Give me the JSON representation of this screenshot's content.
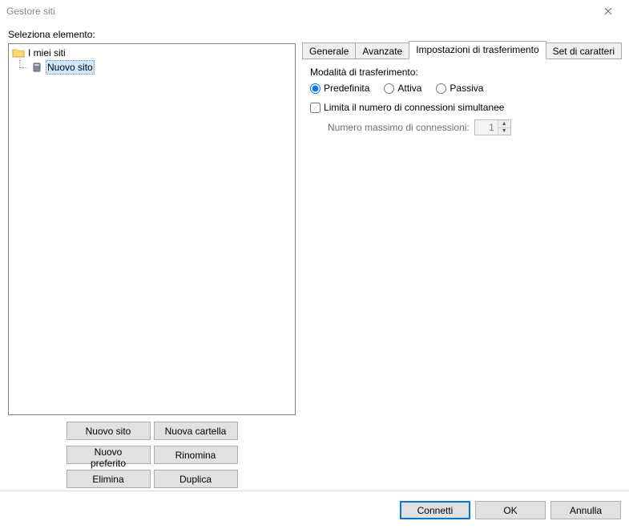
{
  "window": {
    "title": "Gestore siti"
  },
  "left": {
    "label": "Seleziona elemento:",
    "tree": {
      "root": {
        "label": "I miei siti"
      },
      "child": {
        "label": "Nuovo sito",
        "selected": true
      }
    },
    "buttons": {
      "new_site": "Nuovo sito",
      "new_folder": "Nuova cartella",
      "new_bookmark": "Nuovo preferito",
      "rename": "Rinomina",
      "delete": "Elimina",
      "duplicate": "Duplica"
    }
  },
  "tabs": {
    "general": "Generale",
    "advanced": "Avanzate",
    "transfer": "Impostazioni di trasferimento",
    "charset": "Set di caratteri",
    "active_index": 2
  },
  "transfer_page": {
    "mode_label": "Modalità di trasferimento:",
    "radios": {
      "default": "Predefinita",
      "active": "Attiva",
      "passive": "Passiva",
      "selected": "default"
    },
    "limit_check": {
      "label": "Limita il numero di connessioni simultanee",
      "checked": false
    },
    "max_conn": {
      "label": "Numero massimo di connessioni:",
      "value": "1"
    }
  },
  "footer": {
    "connect": "Connetti",
    "ok": "OK",
    "cancel": "Annulla"
  }
}
